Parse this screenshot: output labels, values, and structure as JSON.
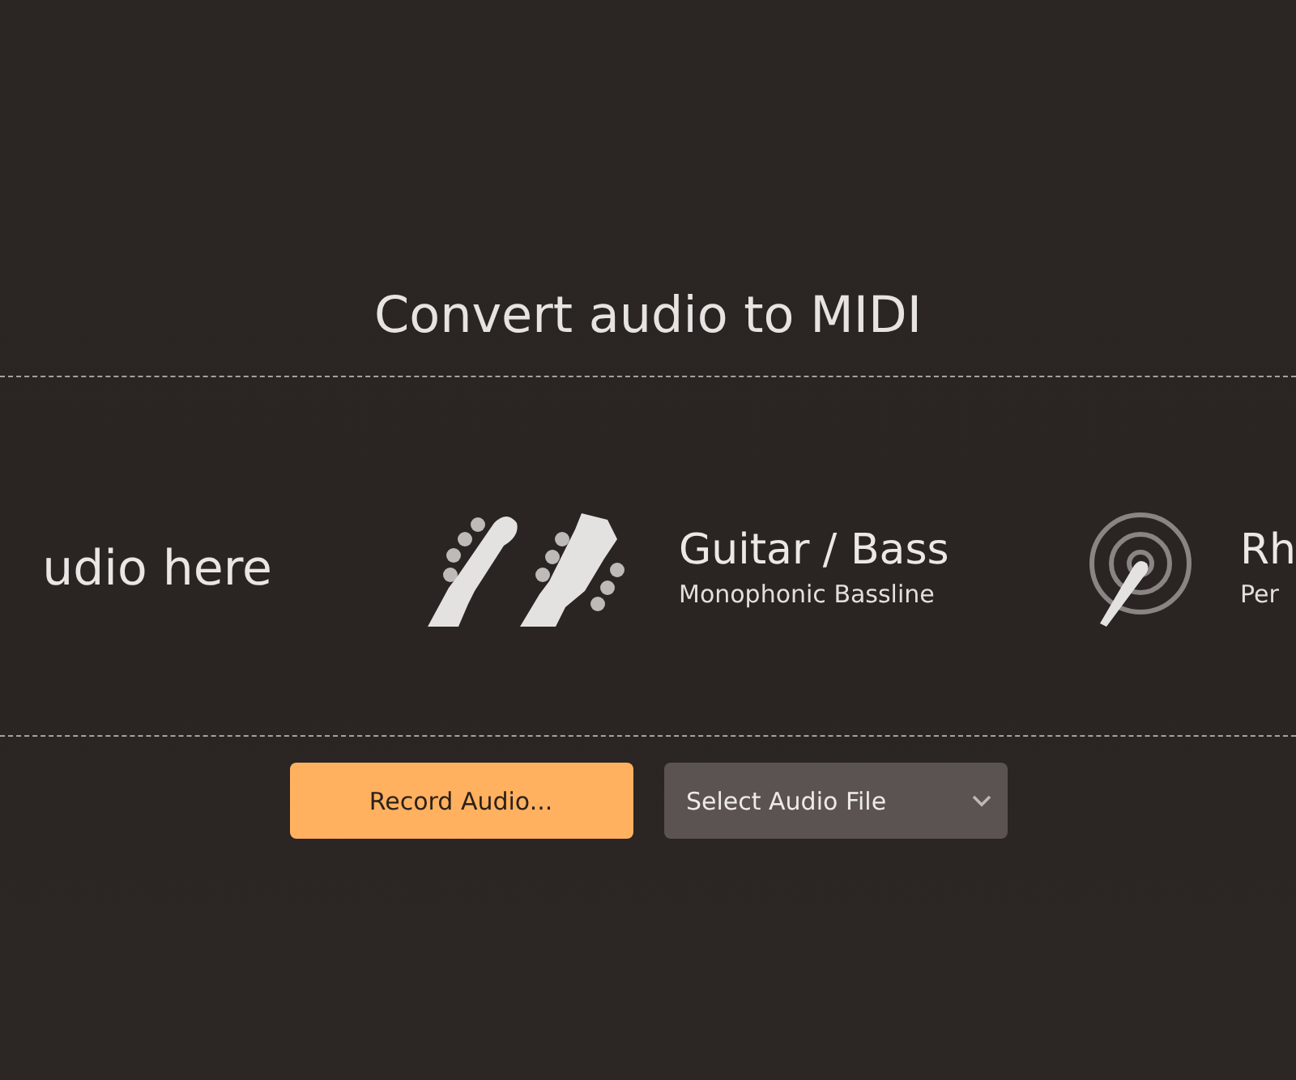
{
  "title": "Convert audio to MIDI",
  "modes": [
    {
      "kind": "drop",
      "label": "udio here"
    },
    {
      "kind": "guitar",
      "name": "Guitar / Bass",
      "description": "Monophonic Bassline"
    },
    {
      "kind": "drum",
      "name": "Rh",
      "description": "Per"
    }
  ],
  "record_button": "Record Audio...",
  "file_select": {
    "value": "Select Audio File"
  }
}
